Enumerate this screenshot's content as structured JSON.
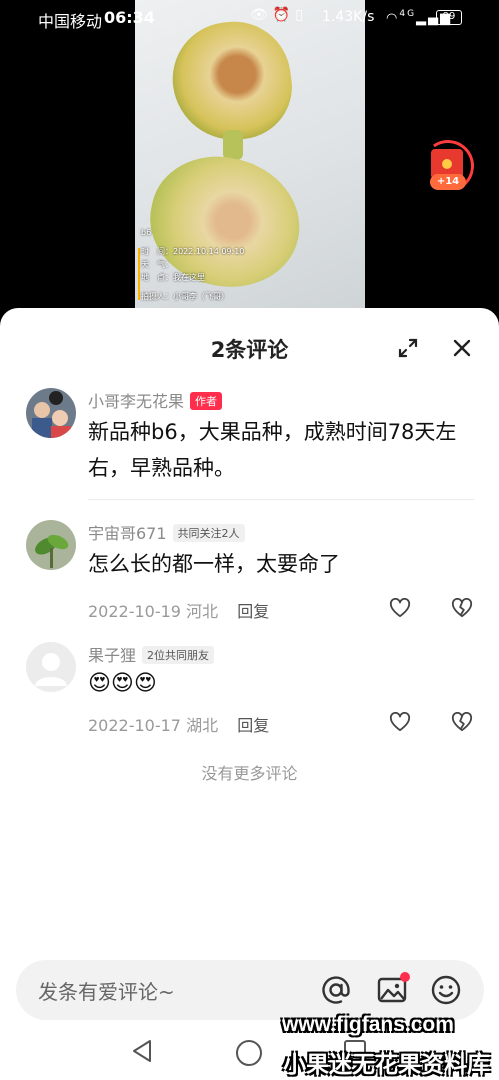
{
  "status_bar": {
    "carrier": "中国移动",
    "time": "06:34",
    "speed": "1.43K/s",
    "network": "4G",
    "battery": "99"
  },
  "video": {
    "photo_label": "b6",
    "photo_time": "时　间：2022.10.14 09:10",
    "photo_weather": "天　气：",
    "photo_location": "地　点：我在这里",
    "photo_author": "拍摄人：小哥李（飞哥）",
    "reward_text": "+14"
  },
  "sheet": {
    "title": "2条评论"
  },
  "comments": [
    {
      "name": "小哥李无花果",
      "badge": "作者",
      "text": "新品种b6，大果品种，成熟时间78天左右，早熟品种。"
    },
    {
      "name": "宇宙哥671",
      "badge": "共同关注2人",
      "text": "怎么长的都一样，太要命了",
      "date": "2022-10-19",
      "region": "河北",
      "reply": "回复"
    },
    {
      "name": "果子狸",
      "badge": "2位共同朋友",
      "text": "😍😍😍",
      "date": "2022-10-17",
      "region": "湖北",
      "reply": "回复"
    }
  ],
  "no_more": "没有更多评论",
  "input": {
    "placeholder": "发条有爱评论~"
  },
  "watermark": {
    "site": "www.figfans.com",
    "name": "小果迷无花果资料库"
  },
  "colors": {
    "accent": "#ff2e4d",
    "text_primary": "#111111",
    "text_secondary": "#8a8a8a"
  }
}
